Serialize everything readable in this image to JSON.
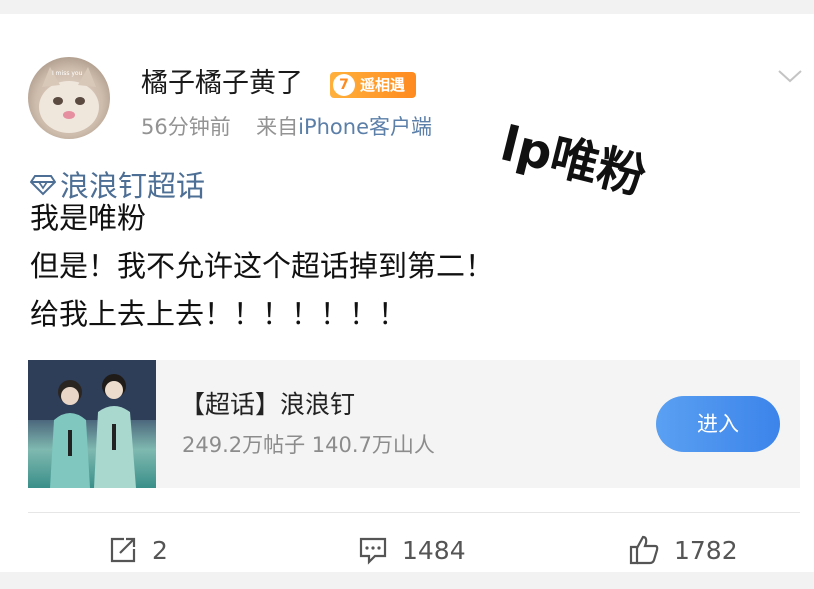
{
  "post": {
    "username": "橘子橘子黄了",
    "badge_level": "7",
    "badge_text": "遥相遇",
    "time": "56分钟前",
    "from_prefix": "来自",
    "source": "iPhone客户端",
    "overlay_text": "lp唯粉",
    "topic_tag": "浪浪钉超话",
    "lines": [
      "我是唯粉",
      "但是！我不允许这个超话掉到第二！",
      "给我上去上去！！！！！！！"
    ]
  },
  "topic_card": {
    "title": "【超话】浪浪钉",
    "stats": "249.2万帖子 140.7万山人",
    "enter_label": "进入"
  },
  "actions": {
    "repost": "2",
    "comment": "1484",
    "like": "1782"
  },
  "icons": {
    "avatar": "cat-avatar",
    "topic": "diamond-icon",
    "more": "chevron-down-icon",
    "repost": "repost-icon",
    "comment": "comment-icon",
    "like": "thumbs-up-icon"
  },
  "colors": {
    "link": "#4e6f95",
    "badge": "#ff8a1f",
    "button": "#3c84ea"
  }
}
